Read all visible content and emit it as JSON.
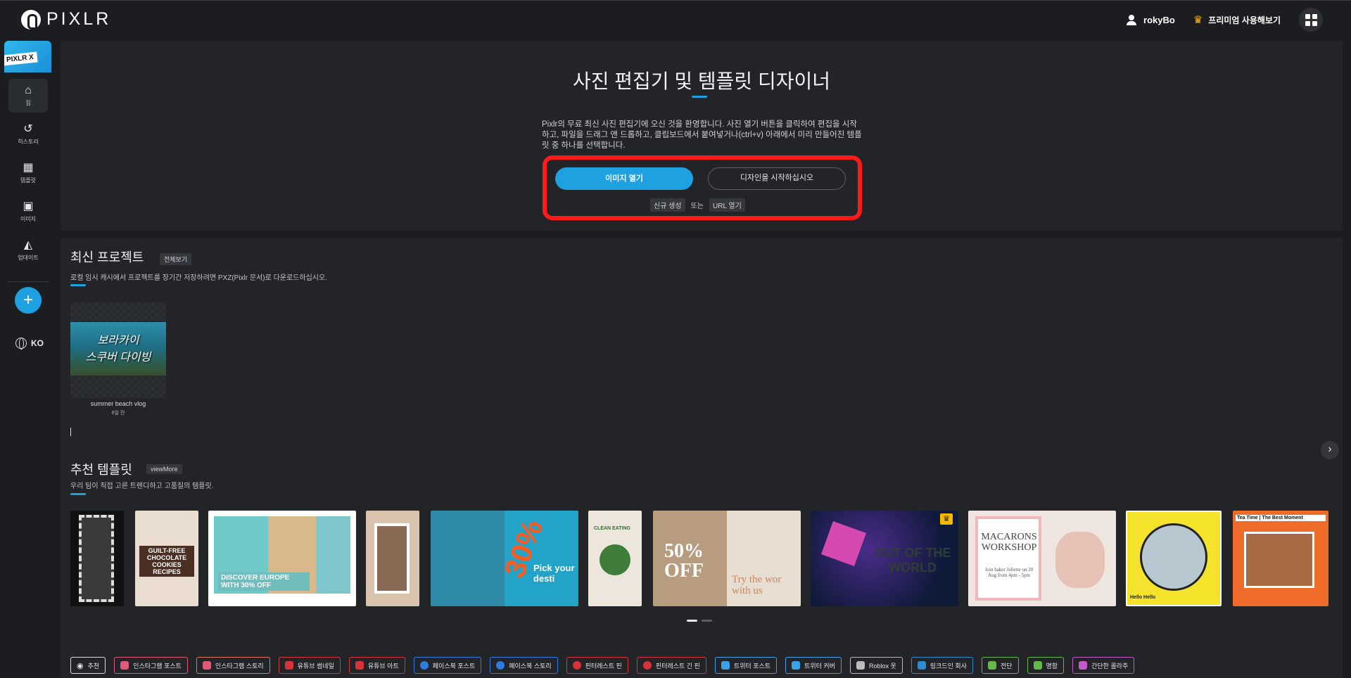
{
  "header": {
    "logo_text": "PIXLR",
    "username": "rokyBo",
    "premium_label": "프리미엄 사용해보기"
  },
  "sidebar": {
    "badge": "PIXLR X",
    "items": [
      {
        "label": "집",
        "icon": "home-icon"
      },
      {
        "label": "히스토리",
        "icon": "history-icon"
      },
      {
        "label": "템플릿",
        "icon": "template-icon"
      },
      {
        "label": "이미지",
        "icon": "image-icon"
      },
      {
        "label": "업데이트",
        "icon": "megaphone-icon"
      }
    ],
    "language": "KO"
  },
  "hero": {
    "title": "사진 편집기 및 템플릿 디자이너",
    "description": "Pixlr의 무료 최신 사진 편집기에 오신 것을 환영합니다. 사진 열기 버튼을 클릭하여 편집을 시작하고, 파일을 드래그 앤 드롭하고, 클립보드에서 붙여넣거나(ctrl+v) 아래에서 미리 만들어진 템플릿 중 하나를 선택합니다.",
    "open_image_label": "이미지 열기",
    "start_design_label": "디자인을 시작하십시오",
    "new_label": "신규 생성",
    "or_label": "또는",
    "url_label": "URL 열기"
  },
  "recent": {
    "title": "최신 프로젝트",
    "view_all": "전체보기",
    "subtitle": "로컬 임시 캐시에서 프로젝트를 장기간 저장하려면 PXZ(Pixlr 문서)로 다운로드하십시오.",
    "project": {
      "thumb_line1": "보라카이",
      "thumb_line2": "스쿠버 다이빙",
      "name": "summer beach vlog",
      "time": "8일 전"
    }
  },
  "templates": {
    "title": "추천 템플릿",
    "view_more": "viewMore",
    "subtitle": "우리 팀이 직접 고른 트렌디하고 고품질의 템플릿.",
    "cards": [
      {
        "name": "template-film-strip"
      },
      {
        "name": "template-cookies",
        "text": "GUILT-FREE CHOCOLATE COOKIES RECIPES"
      },
      {
        "name": "template-discover-europe",
        "text": "DISCOVER EUROPE WITH 30% OFF"
      },
      {
        "name": "template-coffee-story"
      },
      {
        "name": "template-travel-30",
        "text": "30%",
        "text2": "Pick your desti"
      },
      {
        "name": "template-clean-eating",
        "text": "CLEAN EATING"
      },
      {
        "name": "template-50-off",
        "text": "50% OFF",
        "text2": "Try the wor with us"
      },
      {
        "name": "template-3d-world",
        "text": "OUT OF THE WORLD"
      },
      {
        "name": "template-macarons",
        "text": "MACARONS WORKSHOP",
        "text2": "Join baker Juliette on 20 Aug from 4pm - 5pm"
      },
      {
        "name": "template-yellow-circle",
        "text": "Hello Hello"
      },
      {
        "name": "template-tea-time",
        "text": "Tea Time | The Best Moment"
      }
    ]
  },
  "categories": [
    {
      "label": "추천",
      "color": "#dddddd"
    },
    {
      "label": "인스타그램 포스트",
      "color": "#e05a77"
    },
    {
      "label": "인스타그램 스토리",
      "color": "#e07a5a"
    },
    {
      "label": "유튜브 썸네일",
      "color": "#d8333b"
    },
    {
      "label": "유튜브 아트",
      "color": "#d8333b"
    },
    {
      "label": "페이스북 포스트",
      "color": "#2f7be0"
    },
    {
      "label": "페이스북 스토리",
      "color": "#2f7be0"
    },
    {
      "label": "핀터레스트 핀",
      "color": "#d8333b"
    },
    {
      "label": "핀터레스트 긴 핀",
      "color": "#d8333b"
    },
    {
      "label": "트위터 포스트",
      "color": "#3aa0e8"
    },
    {
      "label": "트위터 커버",
      "color": "#3aa0e8"
    },
    {
      "label": "Roblox 옷",
      "color": "#bbbbbb"
    },
    {
      "label": "링크드인 회사",
      "color": "#2f8bd0"
    },
    {
      "label": "전단",
      "color": "#66b84a"
    },
    {
      "label": "명함",
      "color": "#66b84a"
    },
    {
      "label": "간단한 콜라주",
      "color": "#c45ac8"
    }
  ]
}
